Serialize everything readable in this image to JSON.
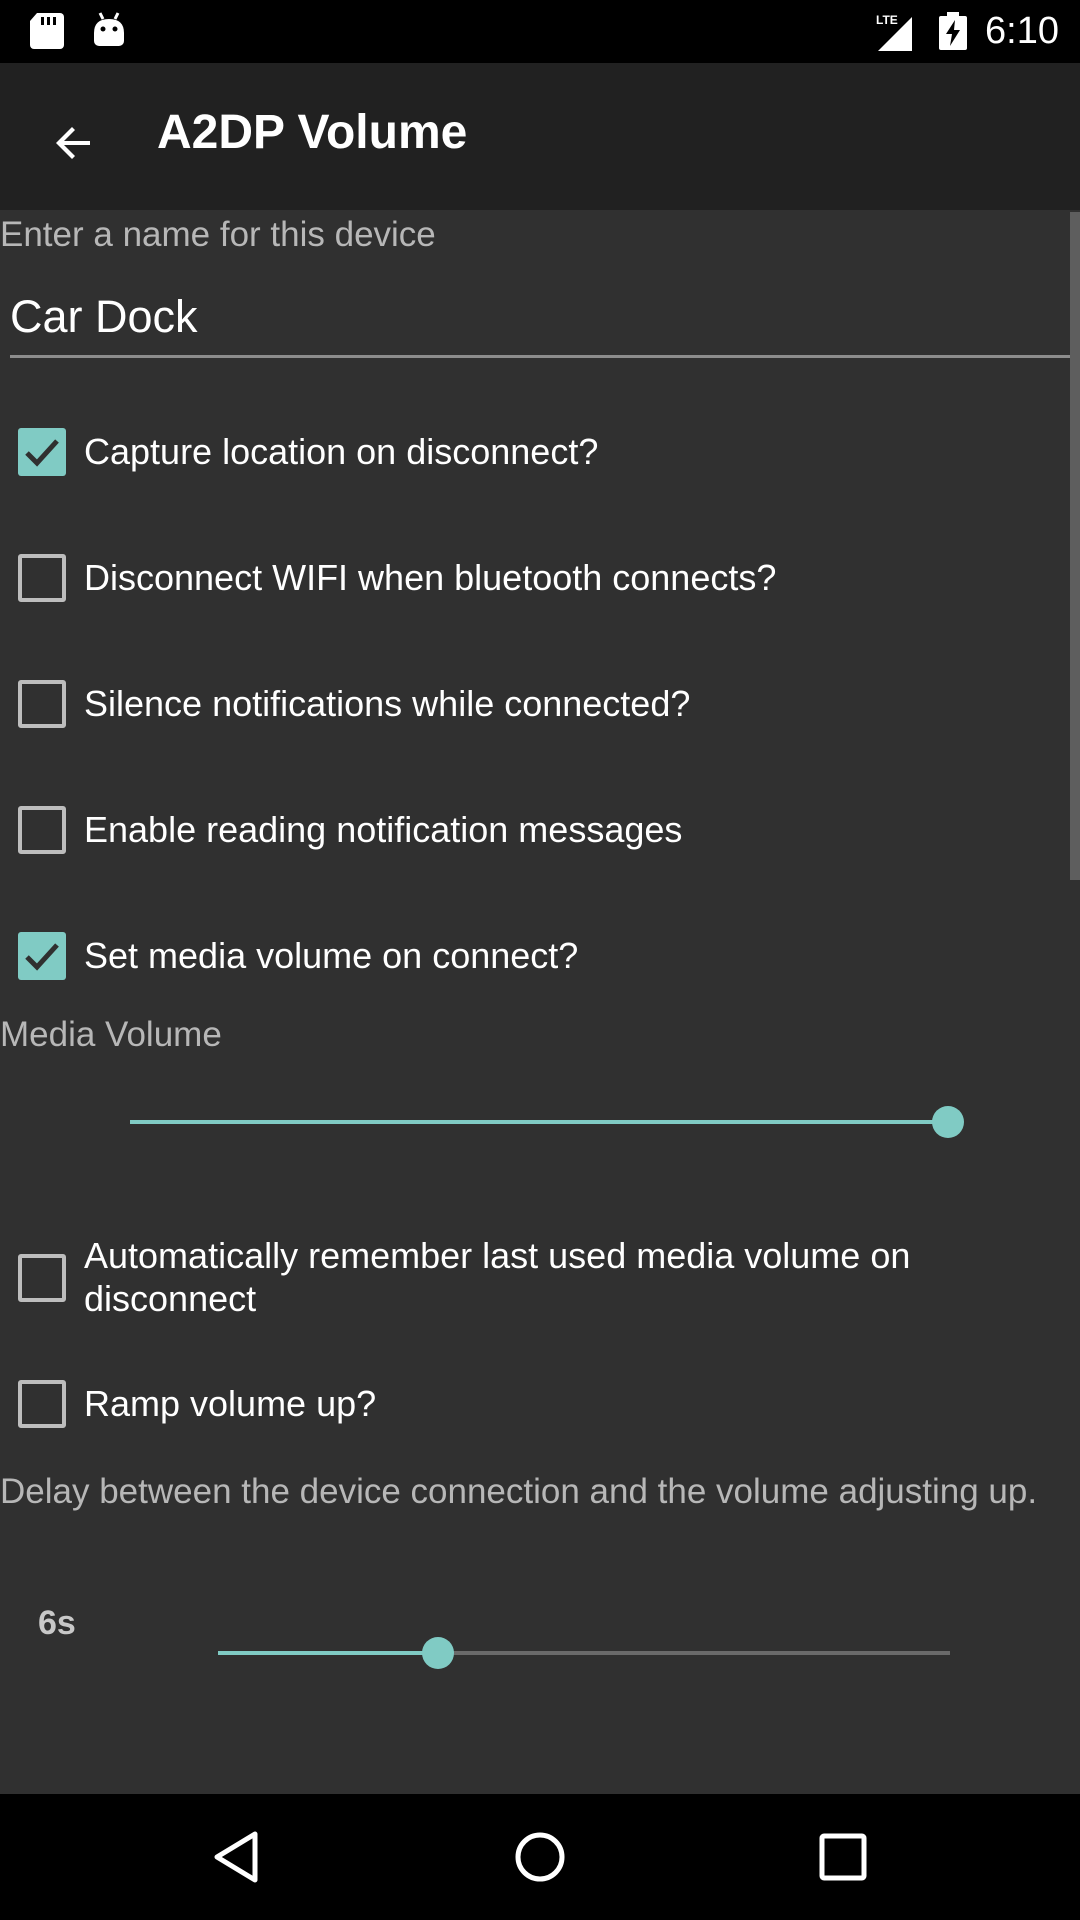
{
  "status_bar": {
    "network": "LTE",
    "time": "6:10"
  },
  "toolbar": {
    "title": "A2DP Volume"
  },
  "device_name": {
    "label": "Enter a name for this device",
    "value": "Car Dock"
  },
  "options": [
    {
      "label": "Capture location on disconnect?",
      "checked": true
    },
    {
      "label": "Disconnect WIFI when bluetooth connects?",
      "checked": false
    },
    {
      "label": "Silence notifications while connected?",
      "checked": false
    },
    {
      "label": "Enable reading notification messages",
      "checked": false
    },
    {
      "label": "Set media volume on connect?",
      "checked": true
    }
  ],
  "media_volume": {
    "label": "Media Volume",
    "level_fraction": 1.0
  },
  "remember_volume": {
    "label": "Automatically remember last used media volume on disconnect",
    "checked": false
  },
  "ramp_volume": {
    "label": "Ramp volume up?",
    "checked": false
  },
  "delay": {
    "label": "Delay between the device connection and the volume adjusting up.",
    "value_text": "6s",
    "level_fraction": 0.3
  },
  "colors": {
    "accent": "#80cbc4",
    "background": "#303030",
    "toolbar": "#212121"
  }
}
